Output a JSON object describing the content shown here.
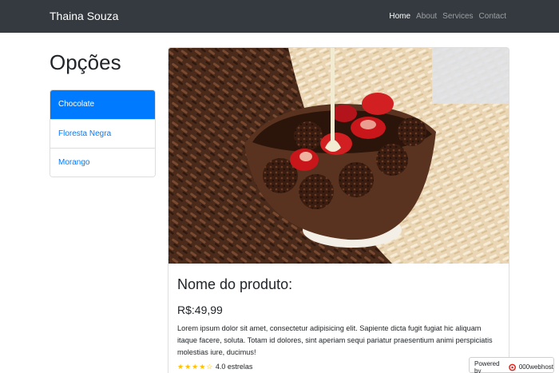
{
  "navbar": {
    "brand": "Thaina Souza",
    "links": [
      {
        "label": "Home",
        "active": true
      },
      {
        "label": "About",
        "active": false
      },
      {
        "label": "Services",
        "active": false
      },
      {
        "label": "Contact",
        "active": false
      }
    ]
  },
  "sidebar": {
    "title": "Opções",
    "items": [
      {
        "label": "Chocolate",
        "active": true
      },
      {
        "label": "Floresta Negra",
        "active": false
      },
      {
        "label": "Morango",
        "active": false
      }
    ]
  },
  "product": {
    "name": "Nome do produto:",
    "price": "R$:49,99",
    "description": "Lorem ipsum dolor sit amet, consectetur adipisicing elit. Sapiente dicta fugit fugiat hic aliquam itaque facere, soluta. Totam id dolores, sint aperiam sequi pariatur praesentium animi perspiciatis molestias iure, ducimus!",
    "stars": "★★★★☆",
    "rating_text": "4.0 estrelas",
    "rating_value": 4.0
  },
  "badge": {
    "prefix": "Powered by",
    "name": "000webhost"
  },
  "colors": {
    "navbar": "#343a40",
    "primary": "#007bff",
    "star": "#ffc107"
  }
}
